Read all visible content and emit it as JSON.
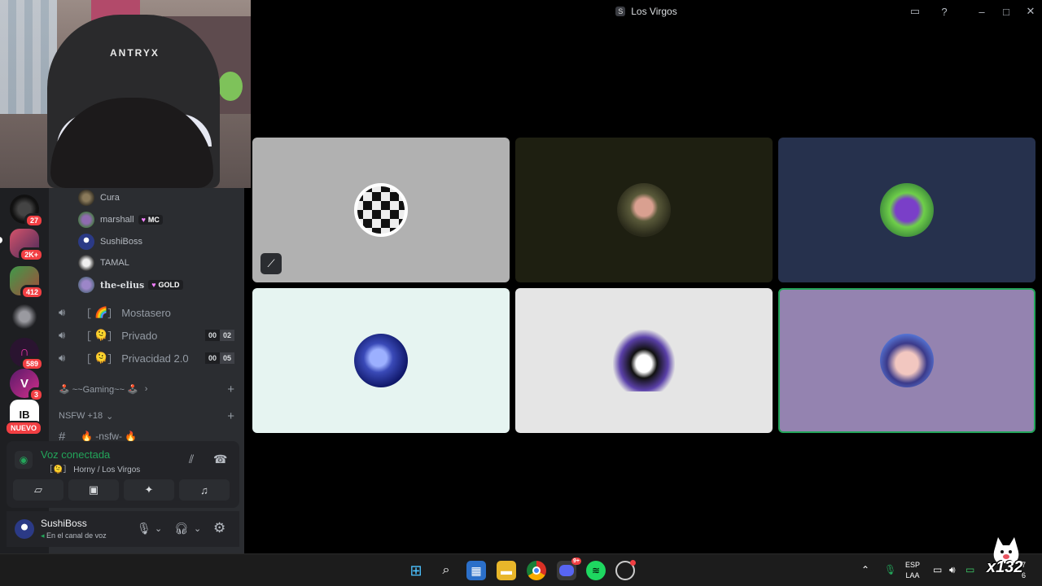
{
  "window": {
    "title": "Los Virgos",
    "title_icon_letter": "S"
  },
  "server_badges": [
    "27",
    "2K+",
    "412",
    "589",
    "3"
  ],
  "nuevo_label": "NUEVO",
  "voice_users": [
    {
      "name": "Cura",
      "tag": ""
    },
    {
      "name": "marshall",
      "tag": "MC"
    },
    {
      "name": "SushiBoss",
      "tag": ""
    },
    {
      "name": "TAMAL",
      "tag": ""
    },
    {
      "name": "the-elius",
      "tag": "GOLD"
    }
  ],
  "voice_channels": [
    {
      "name": "Mostasero",
      "emoji": "🌈",
      "count_a": "",
      "count_b": ""
    },
    {
      "name": "Privado",
      "emoji": "🫠",
      "count_a": "00",
      "count_b": "02"
    },
    {
      "name": "Privacidad 2.0",
      "emoji": "🫠",
      "count_a": "00",
      "count_b": "05"
    }
  ],
  "categories": [
    {
      "name": "🕹️ ~~Gaming~~ 🕹️"
    },
    {
      "name": "NSFW +18"
    }
  ],
  "text_channel": "🔥 -nsfw- 🔥",
  "voice_status": {
    "title": "Voz conectada",
    "subtitle": "Horny / Los Virgos"
  },
  "user": {
    "name": "SushiBoss",
    "status": "En el canal de voz"
  },
  "webcam": {
    "chair_brand": "ANTRYX"
  },
  "tiles": [
    {
      "id": "tile-1",
      "bg": "#b1b1b1",
      "muted": true
    },
    {
      "id": "tile-2",
      "bg": "#1e1f11",
      "muted": false
    },
    {
      "id": "tile-3",
      "bg": "#26314d",
      "muted": false
    },
    {
      "id": "tile-4",
      "bg": "#e6f4f1",
      "muted": false
    },
    {
      "id": "tile-5",
      "bg": "#e5e5e5",
      "muted": false
    },
    {
      "id": "tile-6",
      "bg": "#9483b0",
      "muted": false,
      "speaking": true
    }
  ],
  "taskbar": {
    "lang_top": "ESP",
    "lang_bottom": "LAA",
    "clock_top": "7",
    "clock_bottom": "6",
    "discord_badge": "9+",
    "mascot_text": "x132"
  },
  "colors": {
    "accent_green": "#23a55a",
    "badge_red": "#f23f43"
  }
}
